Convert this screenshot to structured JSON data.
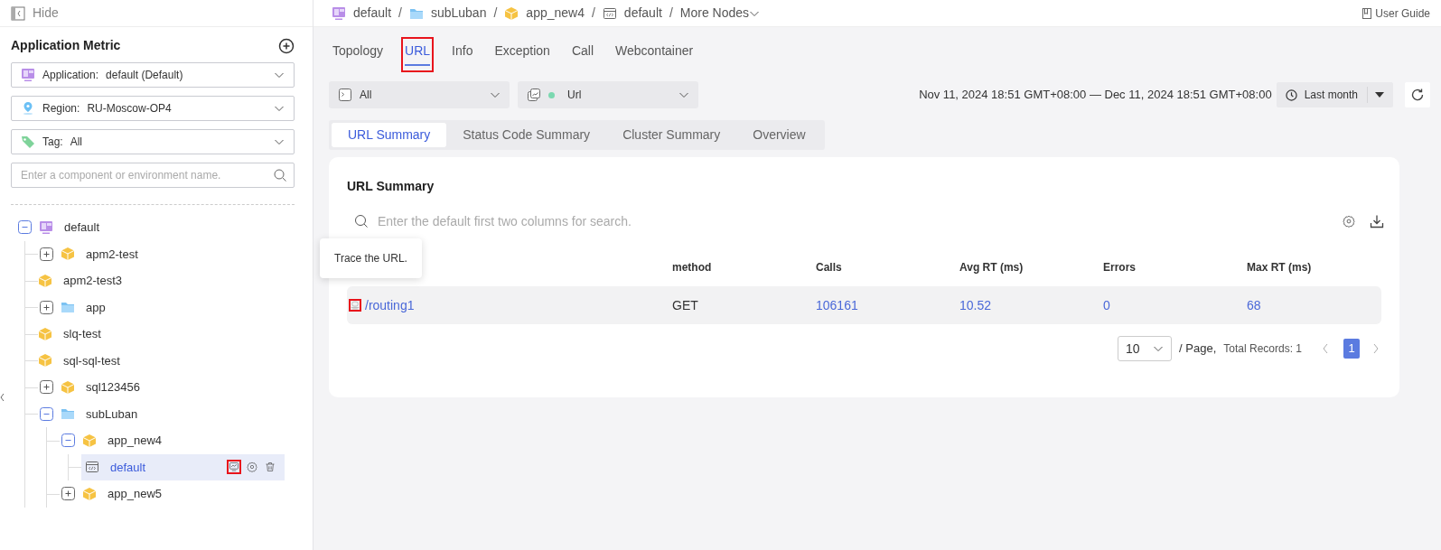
{
  "sidebar": {
    "hide_label": "Hide",
    "title": "Application Metric",
    "filters": [
      {
        "kind": "application",
        "label": "Application:",
        "value": "default (Default)"
      },
      {
        "kind": "region",
        "label": "Region:",
        "value": "RU-Moscow-OP4"
      },
      {
        "kind": "tag",
        "label": "Tag:",
        "value": "All"
      }
    ],
    "search": {
      "placeholder": "Enter a component or environment name."
    },
    "tree": [
      {
        "label": "default",
        "kind": "application",
        "expanded": true,
        "selected": false,
        "children": [
          {
            "label": "apm2-test",
            "kind": "component",
            "expanded": false,
            "selected": false
          },
          {
            "label": "apm2-test3",
            "kind": "component",
            "selected": false
          },
          {
            "label": "app",
            "kind": "folder",
            "expanded": false,
            "selected": false
          },
          {
            "label": "slq-test",
            "kind": "component",
            "selected": false
          },
          {
            "label": "sql-sql-test",
            "kind": "component",
            "selected": false
          },
          {
            "label": "sql123456",
            "kind": "component",
            "expanded": false,
            "selected": false
          },
          {
            "label": "subLuban",
            "kind": "folder",
            "expanded": true,
            "selected": false,
            "children": [
              {
                "label": "app_new4",
                "kind": "component",
                "expanded": true,
                "selected": false,
                "children": [
                  {
                    "label": "default",
                    "kind": "environment",
                    "selected": true,
                    "actions": [
                      {
                        "kind": "monitor",
                        "annotated": true
                      },
                      {
                        "kind": "settings",
                        "annotated": false
                      },
                      {
                        "kind": "delete",
                        "annotated": false
                      }
                    ]
                  }
                ]
              },
              {
                "label": "app_new5",
                "kind": "component",
                "expanded": false,
                "selected": false
              }
            ]
          }
        ]
      }
    ]
  },
  "breadcrumb": [
    {
      "kind": "application",
      "label": "default"
    },
    {
      "kind": "separator",
      "label": "/"
    },
    {
      "kind": "folder",
      "label": "subLuban"
    },
    {
      "kind": "separator",
      "label": "/"
    },
    {
      "kind": "component",
      "label": "app_new4"
    },
    {
      "kind": "separator",
      "label": "/"
    },
    {
      "kind": "environment",
      "label": "default"
    },
    {
      "kind": "separator",
      "label": "/"
    },
    {
      "kind": "more",
      "label": "More Nodes"
    }
  ],
  "user_guide": "User Guide",
  "tabs": [
    {
      "label": "Topology",
      "selected": false,
      "annotated": false
    },
    {
      "label": "URL",
      "selected": true,
      "annotated": true
    },
    {
      "label": "Info",
      "selected": false,
      "annotated": false
    },
    {
      "label": "Exception",
      "selected": false,
      "annotated": false
    },
    {
      "label": "Call",
      "selected": false,
      "annotated": false
    },
    {
      "label": "Webcontainer",
      "selected": false,
      "annotated": false
    }
  ],
  "selectors": [
    {
      "kind": "instance",
      "value": "All"
    },
    {
      "kind": "type",
      "value": "Url"
    }
  ],
  "time_range": {
    "text": "Nov 11, 2024 18:51 GMT+08:00 — Dec 11, 2024 18:51 GMT+08:00",
    "preset": "Last month"
  },
  "subtabs": [
    {
      "label": "URL Summary",
      "selected": true
    },
    {
      "label": "Status Code Summary",
      "selected": false
    },
    {
      "label": "Cluster Summary",
      "selected": false
    },
    {
      "label": "Overview",
      "selected": false
    }
  ],
  "panel": {
    "title": "URL Summary",
    "search": {
      "placeholder": "Enter the default first two columns for search."
    },
    "tooltip": "Trace the URL.",
    "columns": [
      "",
      "method",
      "Calls",
      "Avg RT (ms)",
      "Errors",
      "Max RT (ms)"
    ],
    "rows": [
      {
        "trace_annotated": true,
        "cells": [
          {
            "text": "/routing1",
            "link": true
          },
          {
            "text": "GET",
            "link": false
          },
          {
            "text": "106161",
            "link": true
          },
          {
            "text": "10.52",
            "link": true
          },
          {
            "text": "0",
            "link": true
          },
          {
            "text": "68",
            "link": true
          }
        ]
      }
    ],
    "pagination": {
      "page_size": "10",
      "per_page_label": "/ Page,",
      "total": "Total Records: 1",
      "pages": [
        {
          "label": "1",
          "selected": true
        }
      ]
    }
  }
}
